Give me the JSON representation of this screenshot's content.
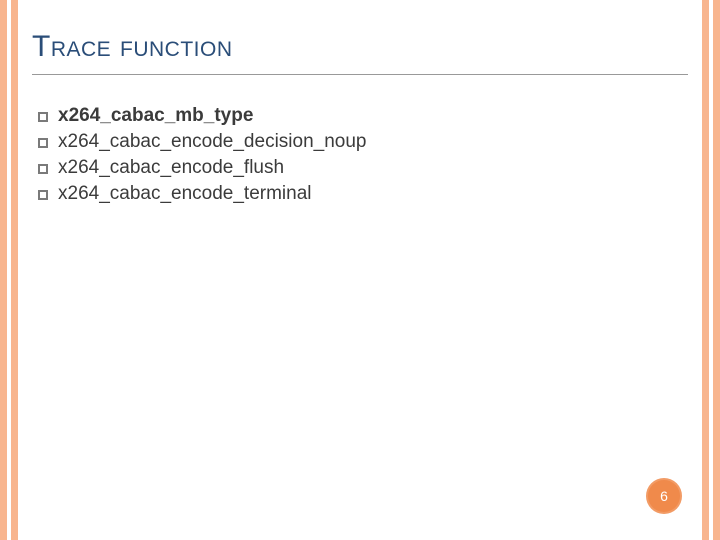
{
  "title": "Trace function",
  "items": [
    {
      "text": "x264_cabac_mb_type",
      "bold": true
    },
    {
      "text": "x264_cabac_encode_decision_noup",
      "bold": false
    },
    {
      "text": "x264_cabac_encode_flush",
      "bold": false
    },
    {
      "text": "x264_cabac_encode_terminal",
      "bold": false
    }
  ],
  "page_number": "6"
}
